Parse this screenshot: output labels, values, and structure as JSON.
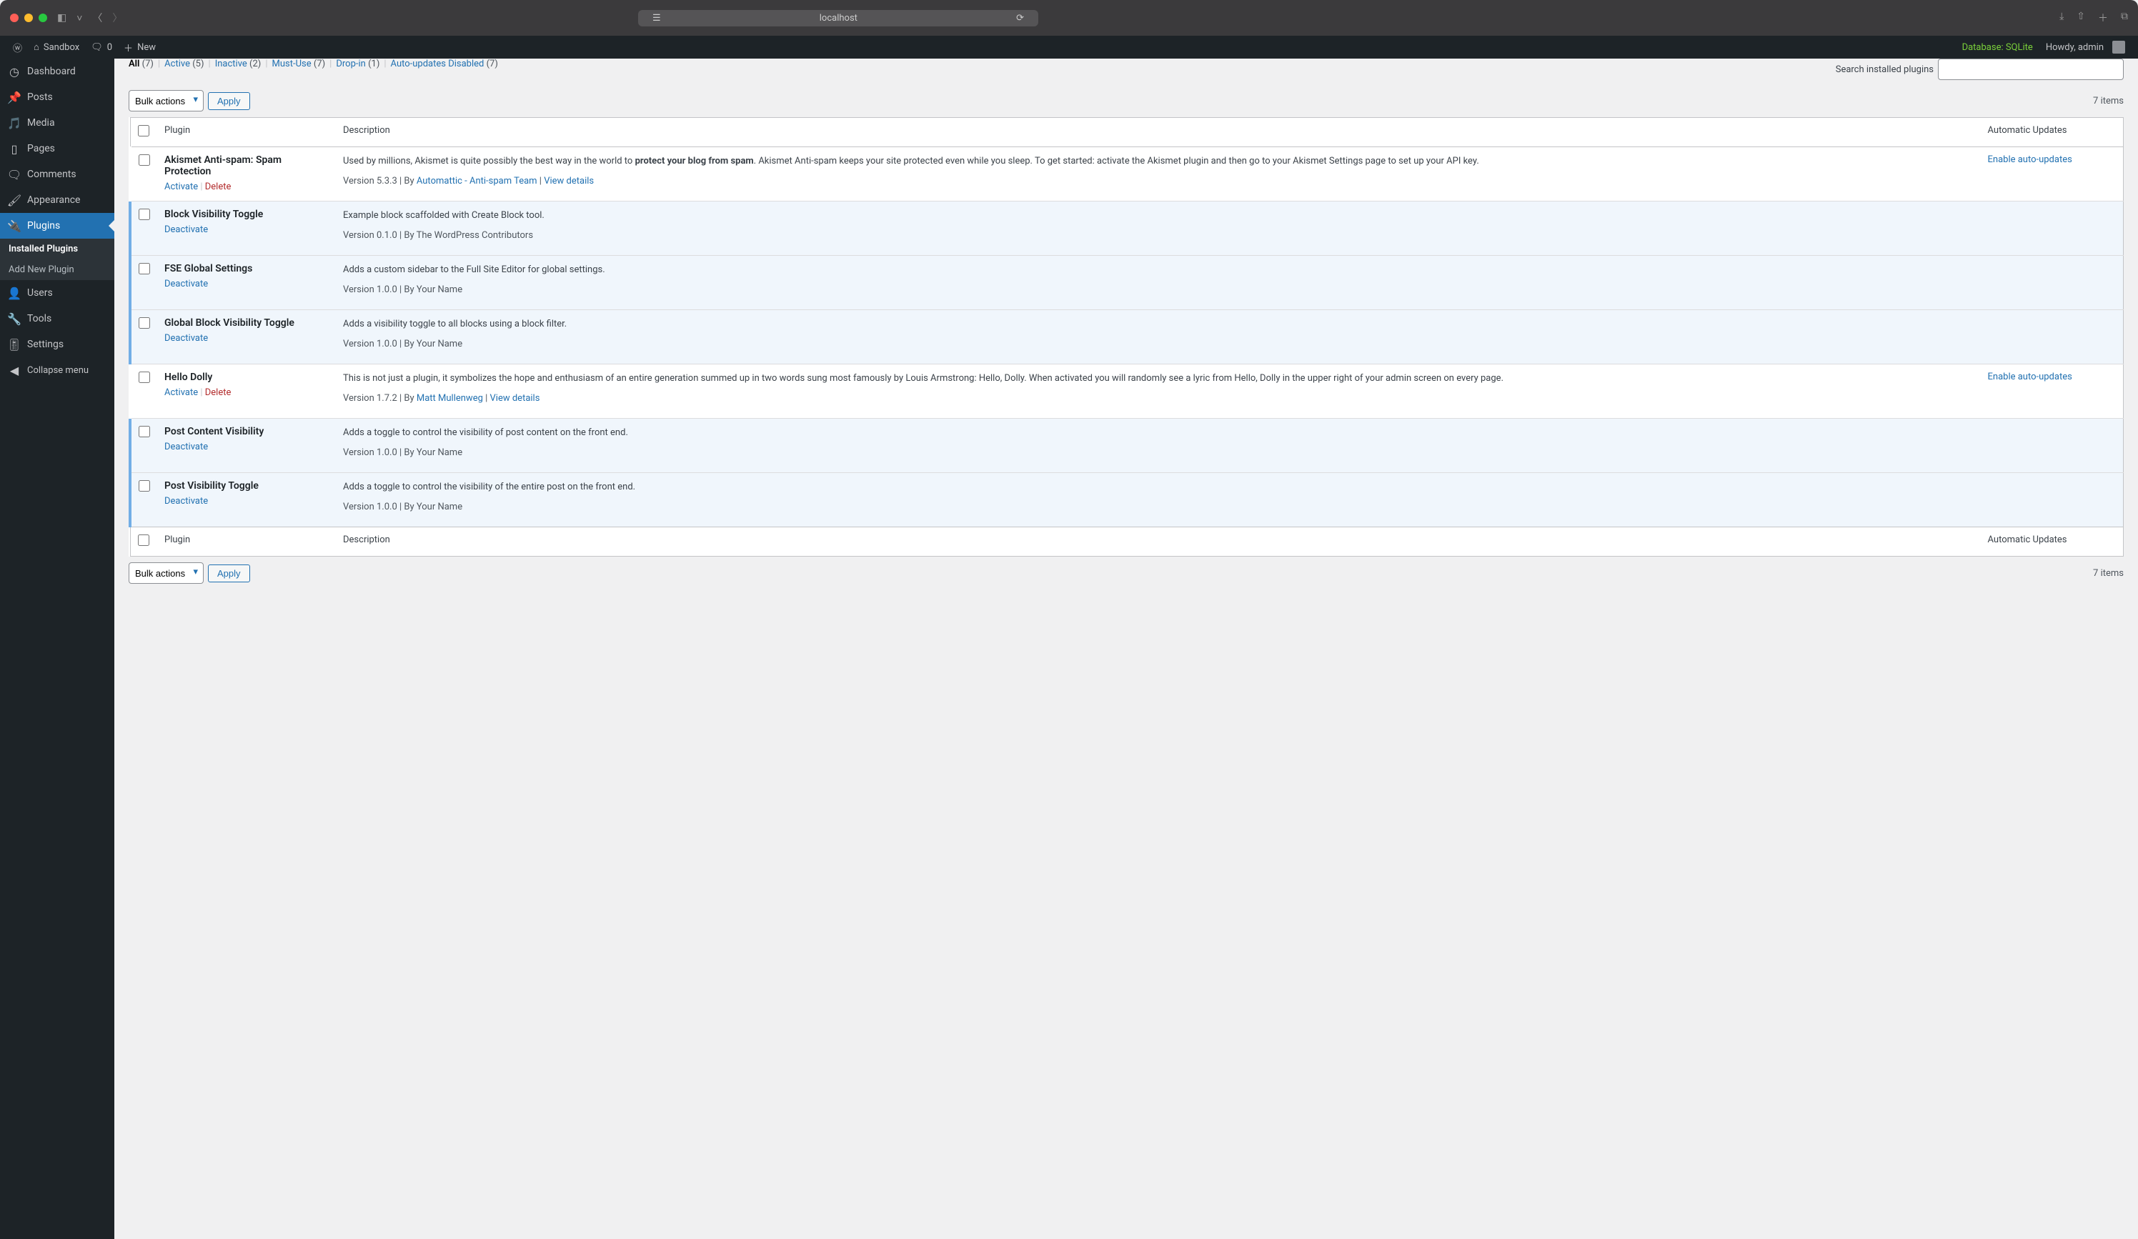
{
  "browser": {
    "url": "localhost"
  },
  "adminbar": {
    "site_name": "Sandbox",
    "comments_count": "0",
    "new_label": "New",
    "db_info": "Database: SQLite",
    "howdy": "Howdy, admin"
  },
  "sidebar": {
    "dashboard": "Dashboard",
    "posts": "Posts",
    "media": "Media",
    "pages": "Pages",
    "comments": "Comments",
    "appearance": "Appearance",
    "plugins": "Plugins",
    "installed_plugins": "Installed Plugins",
    "add_new_plugin": "Add New Plugin",
    "users": "Users",
    "tools": "Tools",
    "settings": "Settings",
    "collapse": "Collapse menu"
  },
  "filters": {
    "all_label": "All",
    "all_count": "(7)",
    "active_label": "Active",
    "active_count": "(5)",
    "inactive_label": "Inactive",
    "inactive_count": "(2)",
    "mustuse_label": "Must-Use",
    "mustuse_count": "(7)",
    "dropin_label": "Drop-in",
    "dropin_count": "(1)",
    "autodisabled_label": "Auto-updates Disabled",
    "autodisabled_count": "(7)"
  },
  "search": {
    "label": "Search installed plugins"
  },
  "bulk": {
    "select_label": "Bulk actions",
    "apply_label": "Apply",
    "item_count": "7 items"
  },
  "columns": {
    "plugin": "Plugin",
    "description": "Description",
    "auto_updates": "Automatic Updates"
  },
  "actions": {
    "activate": "Activate",
    "deactivate": "Deactivate",
    "delete": "Delete",
    "view_details": "View details",
    "enable_auto": "Enable auto-updates"
  },
  "plugins": [
    {
      "name": "Akismet Anti-spam: Spam Protection",
      "active": false,
      "action_primary": "Activate",
      "action_secondary": "Delete",
      "desc_start": "Used by millions, Akismet is quite possibly the best way in the world to ",
      "desc_strong": "protect your blog from spam",
      "desc_end": ". Akismet Anti-spam keeps your site protected even while you sleep. To get started: activate the Akismet plugin and then go to your Akismet Settings page to set up your API key.",
      "version": "Version 5.3.3",
      "by": "By ",
      "author": "Automattic - Anti-spam Team",
      "show_author_link": true,
      "show_view_details": true,
      "auto_updates": true
    },
    {
      "name": "Block Visibility Toggle",
      "active": true,
      "action_primary": "Deactivate",
      "desc_start": "Example block scaffolded with Create Block tool.",
      "desc_strong": "",
      "desc_end": "",
      "version": "Version 0.1.0",
      "by": "By The WordPress Contributors",
      "author": "",
      "show_author_link": false,
      "show_view_details": false,
      "auto_updates": false
    },
    {
      "name": "FSE Global Settings",
      "active": true,
      "action_primary": "Deactivate",
      "desc_start": "Adds a custom sidebar to the Full Site Editor for global settings.",
      "desc_strong": "",
      "desc_end": "",
      "version": "Version 1.0.0",
      "by": "By Your Name",
      "author": "",
      "show_author_link": false,
      "show_view_details": false,
      "auto_updates": false
    },
    {
      "name": "Global Block Visibility Toggle",
      "active": true,
      "action_primary": "Deactivate",
      "desc_start": "Adds a visibility toggle to all blocks using a block filter.",
      "desc_strong": "",
      "desc_end": "",
      "version": "Version 1.0.0",
      "by": "By Your Name",
      "author": "",
      "show_author_link": false,
      "show_view_details": false,
      "auto_updates": false
    },
    {
      "name": "Hello Dolly",
      "active": false,
      "action_primary": "Activate",
      "action_secondary": "Delete",
      "desc_start": "This is not just a plugin, it symbolizes the hope and enthusiasm of an entire generation summed up in two words sung most famously by Louis Armstrong: Hello, Dolly. When activated you will randomly see a lyric from Hello, Dolly in the upper right of your admin screen on every page.",
      "desc_strong": "",
      "desc_end": "",
      "version": "Version 1.7.2",
      "by": "By ",
      "author": "Matt Mullenweg",
      "show_author_link": true,
      "show_view_details": true,
      "auto_updates": true
    },
    {
      "name": "Post Content Visibility",
      "active": true,
      "action_primary": "Deactivate",
      "desc_start": "Adds a toggle to control the visibility of post content on the front end.",
      "desc_strong": "",
      "desc_end": "",
      "version": "Version 1.0.0",
      "by": "By Your Name",
      "author": "",
      "show_author_link": false,
      "show_view_details": false,
      "auto_updates": false
    },
    {
      "name": "Post Visibility Toggle",
      "active": true,
      "action_primary": "Deactivate",
      "desc_start": "Adds a toggle to control the visibility of the entire post on the front end.",
      "desc_strong": "",
      "desc_end": "",
      "version": "Version 1.0.0",
      "by": "By Your Name",
      "author": "",
      "show_author_link": false,
      "show_view_details": false,
      "auto_updates": false
    }
  ]
}
